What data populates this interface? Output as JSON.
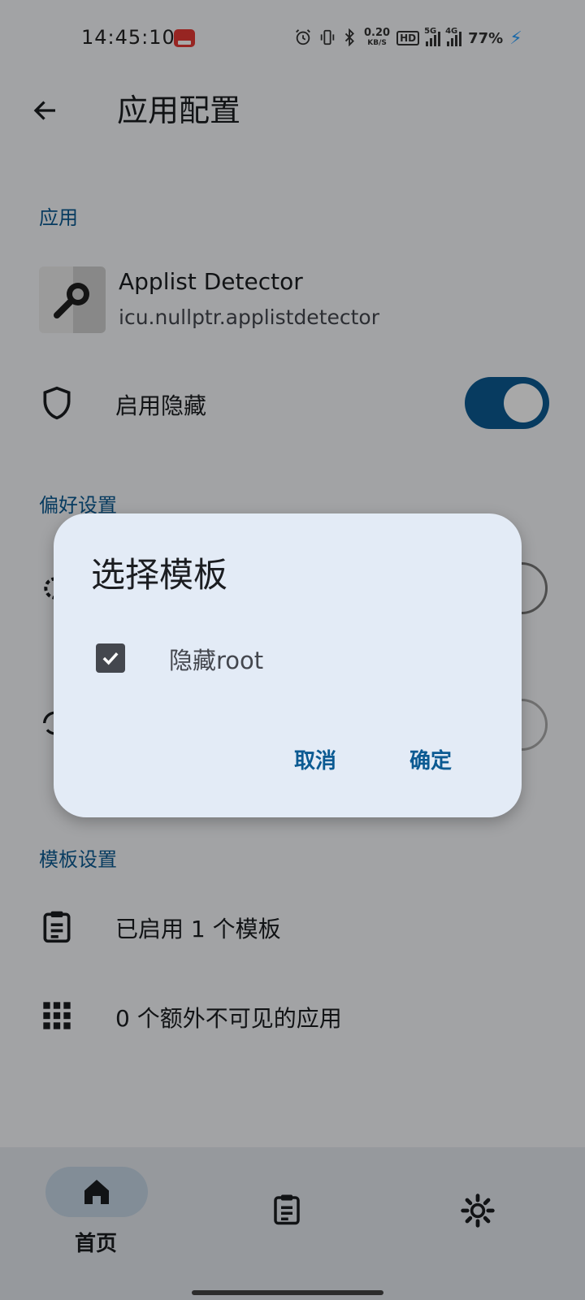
{
  "status_bar": {
    "time": "14:45:10",
    "net_speed_value": "0.20",
    "net_speed_unit": "KB/S",
    "hd_badge": "HD",
    "network_1": "5G",
    "network_2": "4G",
    "battery": "77%"
  },
  "header": {
    "title": "应用配置"
  },
  "app_section": {
    "label": "应用",
    "app_name": "Applist Detector",
    "package": "icu.nullptr.applistdetector",
    "enable_hide_label": "启用隐藏",
    "enable_hide_on": true
  },
  "preferences_section": {
    "label": "偏好设置"
  },
  "template_section": {
    "label": "模板设置",
    "enabled_templates": "已启用 1 个模板",
    "extra_invisible_apps": "0 个额外不可见的应用"
  },
  "bottom_nav": {
    "home_label": "首页"
  },
  "dialog": {
    "title": "选择模板",
    "option_label": "隐藏root",
    "option_checked": true,
    "cancel_label": "取消",
    "confirm_label": "确定"
  },
  "colors": {
    "accent": "#0b5a92",
    "dialog_bg": "#e3ebf6",
    "scrim": "rgba(0,0,0,0.34)"
  }
}
